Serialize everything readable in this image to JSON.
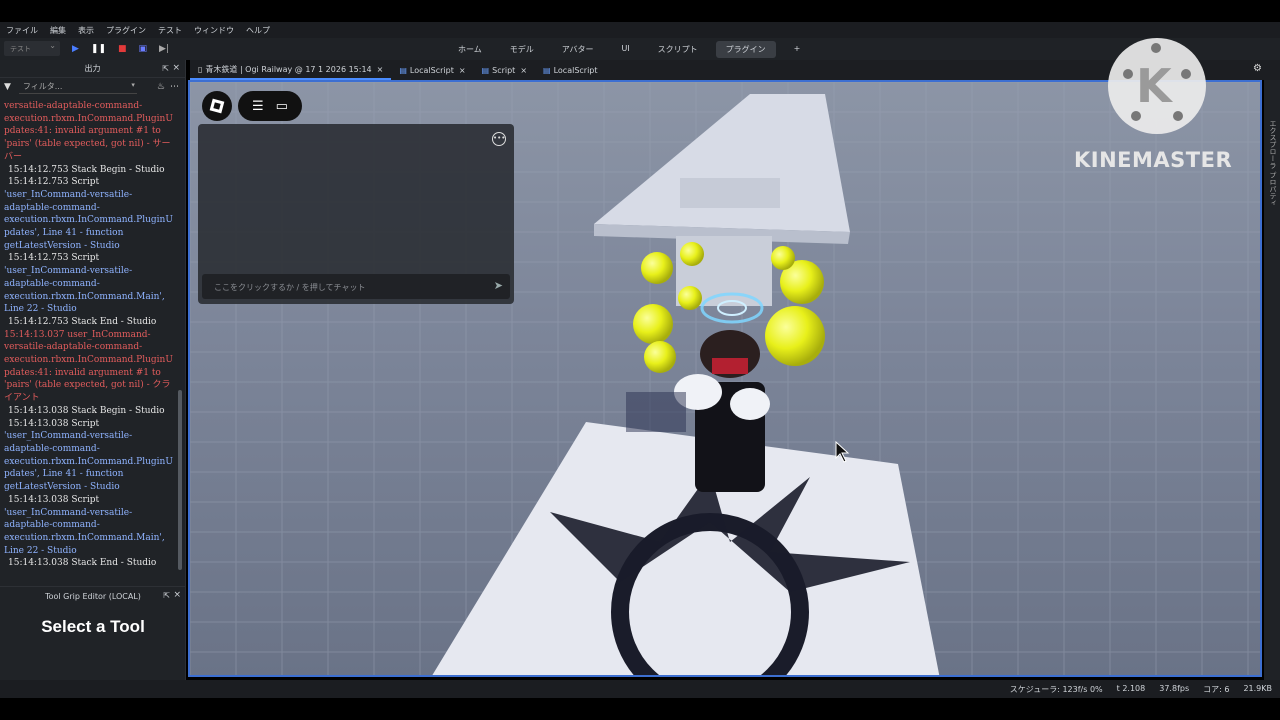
{
  "menu": [
    "ファイル",
    "編集",
    "表示",
    "プラグイン",
    "テスト",
    "ウィンドウ",
    "ヘルプ"
  ],
  "toolbar": {
    "mode_value": "テスト",
    "play_icon": "play-icon",
    "pause_icon": "pause-icon",
    "stop_icon": "stop-icon",
    "ribbon_tabs": [
      "ホーム",
      "モデル",
      "アバター",
      "UI",
      "スクリプト",
      "プラグイン",
      "+"
    ],
    "active_ribbon_tab": "プラグイン"
  },
  "output_panel": {
    "title": "出力",
    "filter_placeholder": "フィルタ...",
    "log_lines": [
      {
        "t": "e",
        "s": "versatile-adaptable-command-"
      },
      {
        "t": "e",
        "s": "execution.rbxm.InCommand.PluginU"
      },
      {
        "t": "e",
        "s": "pdates:41: invalid argument #1 to"
      },
      {
        "t": "e",
        "s": "'pairs' (table expected, got nil) - サー"
      },
      {
        "t": "e",
        "s": "バー"
      },
      {
        "t": "n",
        "s": "15:14:12.753  Stack Begin  -  Studio"
      },
      {
        "t": "n",
        "s": "15:14:12.753  Script"
      },
      {
        "t": "b",
        "s": "'user_InCommand-versatile-"
      },
      {
        "t": "b",
        "s": "adaptable-command-"
      },
      {
        "t": "b",
        "s": "execution.rbxm.InCommand.PluginU"
      },
      {
        "t": "b",
        "s": "pdates', Line 41 - function"
      },
      {
        "t": "b",
        "s": "getLatestVersion  -  Studio"
      },
      {
        "t": "n",
        "s": "15:14:12.753  Script"
      },
      {
        "t": "b",
        "s": "'user_InCommand-versatile-"
      },
      {
        "t": "b",
        "s": "adaptable-command-"
      },
      {
        "t": "b",
        "s": "execution.rbxm.InCommand.Main',"
      },
      {
        "t": "b",
        "s": "Line 22  -  Studio"
      },
      {
        "t": "n",
        "s": "15:14:12.753  Stack End  -  Studio"
      },
      {
        "t": "e",
        "s": "15:14:13.037  user_InCommand-"
      },
      {
        "t": "e",
        "s": "versatile-adaptable-command-"
      },
      {
        "t": "e",
        "s": "execution.rbxm.InCommand.PluginU"
      },
      {
        "t": "e",
        "s": "pdates:41: invalid argument #1 to"
      },
      {
        "t": "e",
        "s": "'pairs' (table expected, got nil) - クラ"
      },
      {
        "t": "e",
        "s": "イアント"
      },
      {
        "t": "n",
        "s": "15:14:13.038  Stack Begin  -  Studio"
      },
      {
        "t": "n",
        "s": "15:14:13.038  Script"
      },
      {
        "t": "b",
        "s": "'user_InCommand-versatile-"
      },
      {
        "t": "b",
        "s": "adaptable-command-"
      },
      {
        "t": "b",
        "s": "execution.rbxm.InCommand.PluginU"
      },
      {
        "t": "b",
        "s": "pdates', Line 41 - function"
      },
      {
        "t": "b",
        "s": "getLatestVersion  -  Studio"
      },
      {
        "t": "n",
        "s": "15:14:13.038  Script"
      },
      {
        "t": "b",
        "s": "'user_InCommand-versatile-"
      },
      {
        "t": "b",
        "s": "adaptable-command-"
      },
      {
        "t": "b",
        "s": "execution.rbxm.InCommand.Main',"
      },
      {
        "t": "b",
        "s": "Line 22  -  Studio"
      },
      {
        "t": "n",
        "s": "15:14:13.038  Stack End  -  Studio"
      }
    ]
  },
  "tool_panel": {
    "title": "Tool Grip Editor (LOCAL)",
    "message": "Select a Tool"
  },
  "doc_tabs": [
    {
      "label": "青木鉄道 | Ogi Railway @ 17 1 2026 15:14",
      "icon": "document-icon"
    },
    {
      "label": "LocalScript",
      "icon": "script-icon"
    },
    {
      "label": "Script",
      "icon": "script-icon"
    },
    {
      "label": "LocalScript",
      "icon": "script-icon"
    }
  ],
  "viewport": {
    "chat_placeholder": "ここをクリックするか / を押してチャット",
    "side_label": "エクスプローラ  プロパティ"
  },
  "watermark": {
    "text": "KINEMASTER"
  },
  "statusbar": {
    "scheduler": "スケジューラ: 123f/s 0%",
    "time": "t 2.108",
    "fps": "37.8fps",
    "cores": "コア: 6",
    "memory": "21.9KB"
  },
  "colors": {
    "accent": "#3d6fd1",
    "error_text": "#e25c5c",
    "info_text": "#8fb3ff",
    "ball": "#e8f01a"
  }
}
